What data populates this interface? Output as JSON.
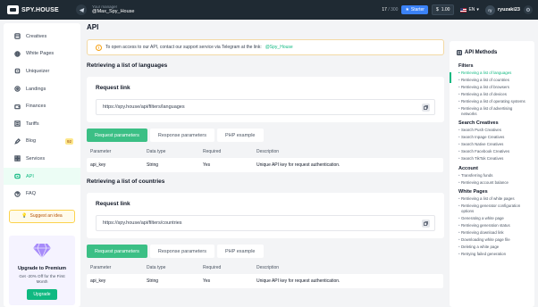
{
  "topbar": {
    "logo": "SPY.HOUSE",
    "manager_label": "Your manager",
    "manager_name": "@Max_Spy_House",
    "quota_used": "17",
    "quota_max": "/ 300",
    "plan": "Starter",
    "balance": "1.00",
    "language": "EN",
    "user_initials": "ry",
    "username": "ryuzaki23"
  },
  "sidebar": {
    "items": [
      {
        "label": "Creatives",
        "icon": "creatives-icon"
      },
      {
        "label": "White Pages",
        "icon": "white-pages-icon"
      },
      {
        "label": "Uniqueizer",
        "icon": "uniqueizer-icon"
      },
      {
        "label": "Landings",
        "icon": "landings-icon"
      },
      {
        "label": "Finances",
        "icon": "finances-icon"
      },
      {
        "label": "Tariffs",
        "icon": "tariffs-icon"
      },
      {
        "label": "Blog",
        "icon": "blog-icon",
        "badge": "92"
      },
      {
        "label": "Services",
        "icon": "services-icon"
      },
      {
        "label": "API",
        "icon": "api-icon",
        "active": true
      },
      {
        "label": "FAQ",
        "icon": "faq-icon"
      }
    ],
    "suggest_label": "Suggest an idea",
    "premium": {
      "title": "Upgrade to Premium",
      "desc": "Get -20% Off for the First Month",
      "button": "Upgrade"
    }
  },
  "main": {
    "title": "API",
    "notice": "To open access to our API, contact our support service via Telegram at the link:",
    "notice_link": "@Spy_House",
    "sections": [
      {
        "title": "Retrieving a list of languages",
        "request_label": "Request link",
        "url": "https://spy.house/api/filters/languages",
        "tabs": [
          "Request parameters",
          "Response parameters",
          "PHP example"
        ],
        "headers": [
          "Parameter",
          "Data type",
          "Required",
          "Description"
        ],
        "row": [
          "api_key",
          "String",
          "Yes",
          "Unique API key for request authentication."
        ]
      },
      {
        "title": "Retrieving a list of countries",
        "request_label": "Request link",
        "url": "https://spy.house/api/filters/countries",
        "tabs": [
          "Request parameters",
          "Response parameters",
          "PHP example"
        ],
        "headers": [
          "Parameter",
          "Data type",
          "Required",
          "Description"
        ],
        "row": [
          "api_key",
          "String",
          "Yes",
          "Unique API key for request authentication."
        ]
      }
    ]
  },
  "rpanel": {
    "title": "API Methods",
    "groups": [
      {
        "name": "Filters",
        "links": [
          "Retrieving a list of languages",
          "Retrieving a list of countries",
          "Retrieving a list of browsers",
          "Retrieving a list of devices",
          "Retrieving a list of operating systems",
          "Retrieving a list of advertising networks"
        ]
      },
      {
        "name": "Search Creatives",
        "links": [
          "Search Push Creatives",
          "Search Inpage Creatives",
          "Search Native Creatives",
          "Search Facebook Creatives",
          "Search TikTok Creatives"
        ]
      },
      {
        "name": "Account",
        "links": [
          "Transferring funds",
          "Retrieving account balance"
        ]
      },
      {
        "name": "White Pages",
        "links": [
          "Retrieving a list of white pages",
          "Retrieving generator configuration options",
          "Generating a white page",
          "Retrieving generation status",
          "Retrieving download link",
          "Downloading white page file",
          "Deleting a white page",
          "Retrying failed generation"
        ]
      }
    ]
  },
  "colors": {
    "accent": "#10b981",
    "topbar": "#1f2a33",
    "starter": "#3b82f6",
    "tab_active": "#3bbf85"
  }
}
